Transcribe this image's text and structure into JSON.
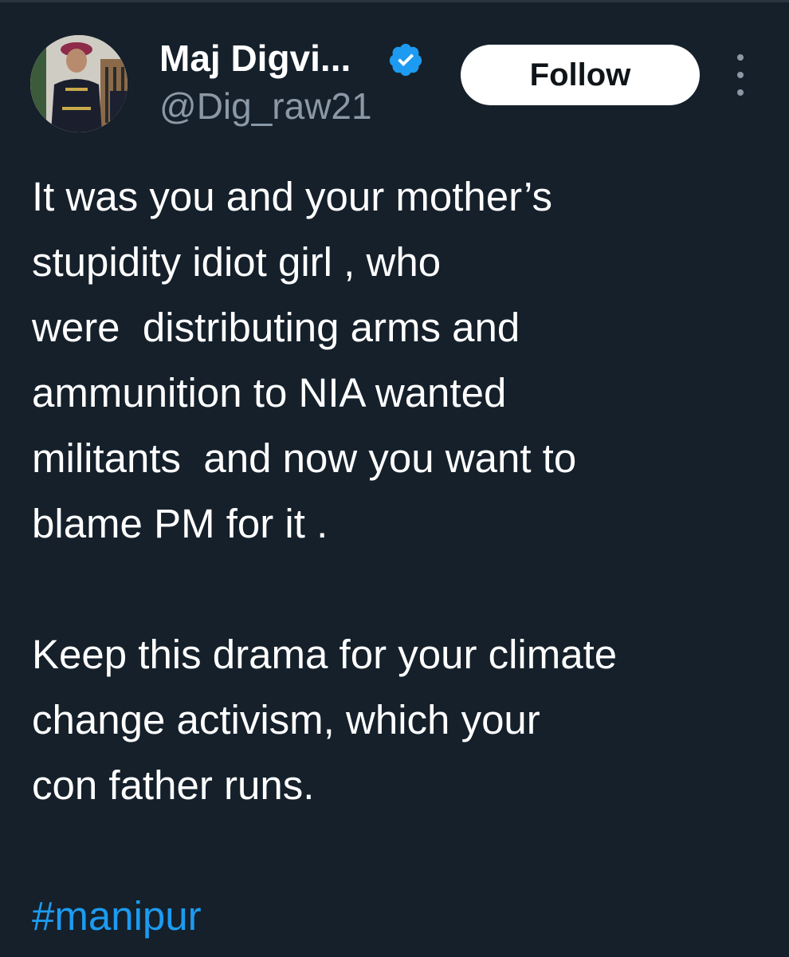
{
  "author": {
    "display_name": "Maj Digvi...",
    "handle": "@Dig_raw21",
    "verified": true
  },
  "actions": {
    "follow_label": "Follow",
    "more_icon": "more-options-icon"
  },
  "tweet": {
    "paragraphs": [
      {
        "lines": [
          "It was you and your mother’s",
          "stupidity idiot girl , who",
          "were  distributing arms and",
          "ammunition to NIA wanted",
          "militants  and now you want to",
          "blame PM for it ."
        ]
      },
      {
        "lines": [
          "Keep this drama for your climate",
          "change activism, which your",
          "con father runs."
        ]
      }
    ],
    "hashtag": "#manipur"
  },
  "colors": {
    "background": "#15202b",
    "text": "#ffffff",
    "secondary_text": "#8b98a5",
    "link": "#1d9bf0",
    "verified": "#1d9bf0",
    "follow_bg": "#ffffff",
    "follow_text": "#0f1419"
  }
}
